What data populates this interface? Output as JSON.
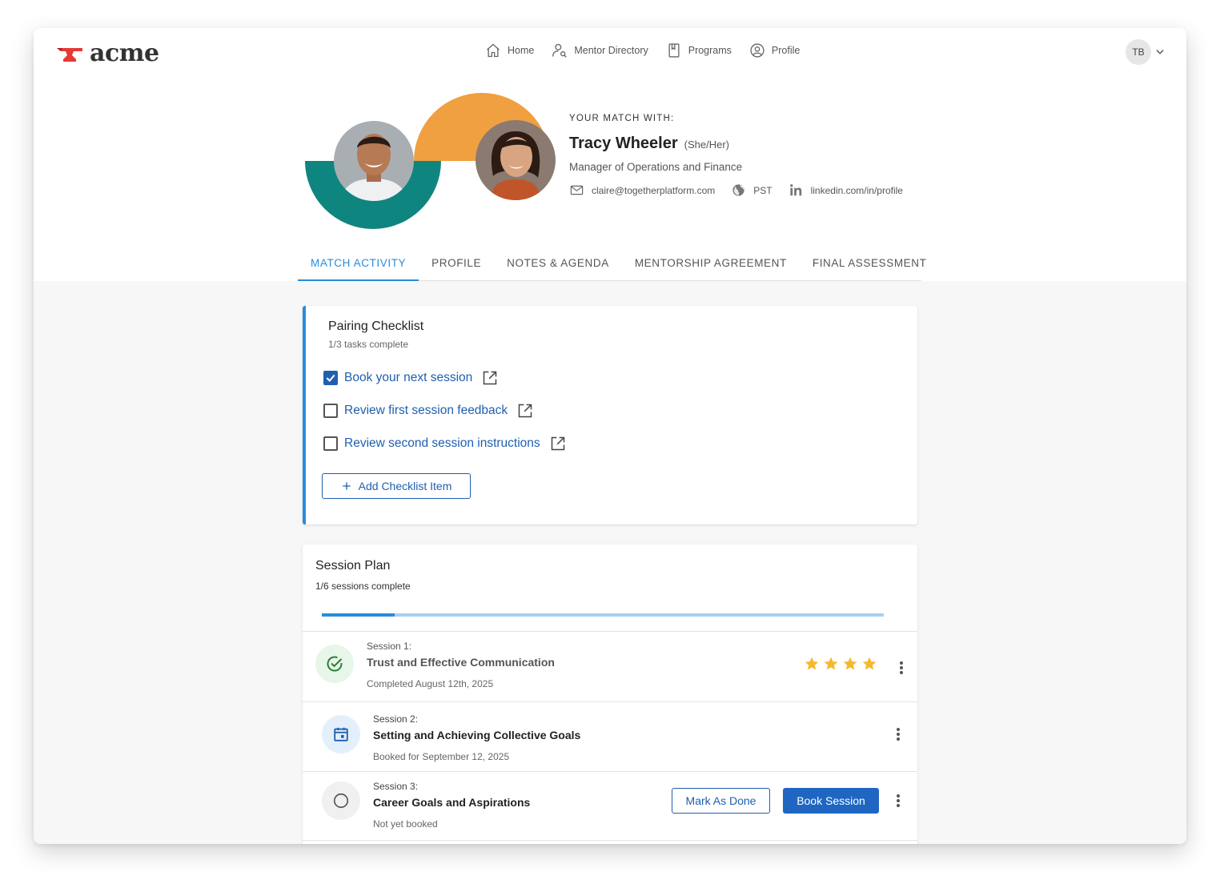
{
  "brand": {
    "name": "acme",
    "accent": "#2a8bd9",
    "link": "#1f5fb0",
    "teal": "#0f8580",
    "orange": "#f0a040"
  },
  "nav": {
    "items": [
      {
        "label": "Home",
        "icon": "home-icon"
      },
      {
        "label": "Mentor Directory",
        "icon": "person-search-icon"
      },
      {
        "label": "Programs",
        "icon": "bookmark-icon"
      },
      {
        "label": "Profile",
        "icon": "user-circle-icon"
      }
    ],
    "user_initials": "TB"
  },
  "match": {
    "eyebrow": "YOUR MATCH WITH:",
    "name": "Tracy Wheeler",
    "pronouns": "(She/Her)",
    "title": "Manager of Operations and Finance",
    "email": "claire@togetherplatform.com",
    "timezone": "PST",
    "linkedin": "linkedin.com/in/profile"
  },
  "tabs": [
    {
      "label": "MATCH ACTIVITY",
      "active": true
    },
    {
      "label": "PROFILE",
      "active": false
    },
    {
      "label": "NOTES & AGENDA",
      "active": false
    },
    {
      "label": "MENTORSHIP AGREEMENT",
      "active": false
    },
    {
      "label": "FINAL ASSESSMENT",
      "active": false
    }
  ],
  "checklist": {
    "title": "Pairing Checklist",
    "subtitle": "1/3 tasks complete",
    "items": [
      {
        "label": "Book your next session",
        "checked": true
      },
      {
        "label": "Review first session feedback",
        "checked": false
      },
      {
        "label": "Review second session instructions",
        "checked": false
      }
    ],
    "add_label": "Add Checklist Item"
  },
  "session_plan": {
    "title": "Session Plan",
    "subtitle": "1/6 sessions complete",
    "progress": 0.13,
    "sessions": [
      {
        "label": "Session 1:",
        "title": "Trust and Effective Communication",
        "meta": "Completed August 12th, 2025",
        "status": "completed",
        "rating": 4
      },
      {
        "label": "Session 2:",
        "title": "Setting and Achieving Collective Goals",
        "meta": "Booked for September 12, 2025",
        "status": "booked"
      },
      {
        "label": "Session 3:",
        "title": "Career Goals and Aspirations",
        "meta": "Not yet booked",
        "status": "pending",
        "mark_done_label": "Mark As Done",
        "book_label": "Book Session"
      }
    ]
  }
}
